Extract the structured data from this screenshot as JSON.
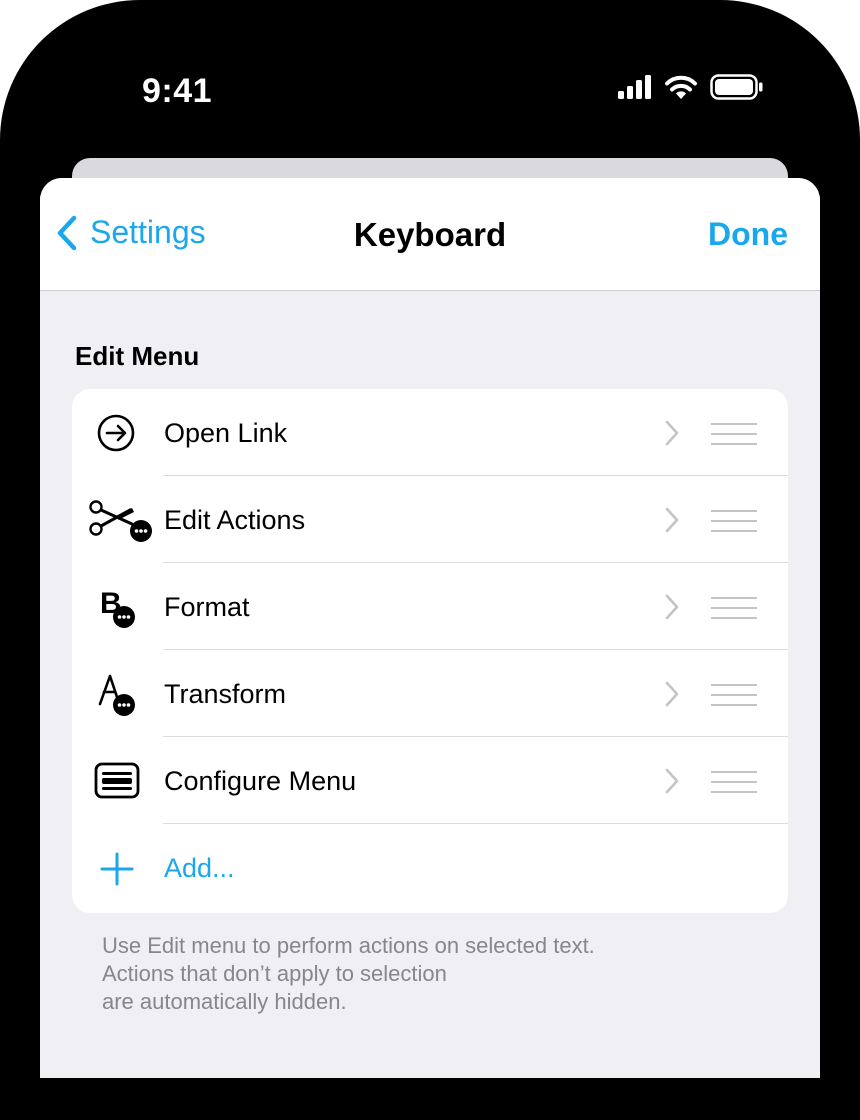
{
  "status_bar": {
    "time": "9:41",
    "icons": [
      "cellular-signal-icon",
      "wifi-icon",
      "battery-icon"
    ]
  },
  "nav": {
    "back_label": "Settings",
    "title": "Keyboard",
    "done_label": "Done"
  },
  "section": {
    "title": "Edit Menu",
    "items": [
      {
        "label": "Open Link",
        "icon": "arrow-circle-icon"
      },
      {
        "label": "Edit Actions",
        "icon": "scissors-more-icon"
      },
      {
        "label": "Format",
        "icon": "bold-more-icon"
      },
      {
        "label": "Transform",
        "icon": "text-transform-icon"
      },
      {
        "label": "Configure Menu",
        "icon": "menu-config-icon"
      }
    ],
    "add_label": "Add...",
    "footnote": [
      "Use Edit menu to perform actions on selected text.",
      "Actions that don’t apply to selection",
      "are automatically hidden."
    ]
  },
  "colors": {
    "accent": "#1aa7ec",
    "background": "#efeff4",
    "card": "#ffffff",
    "secondary_text": "#86868c"
  }
}
